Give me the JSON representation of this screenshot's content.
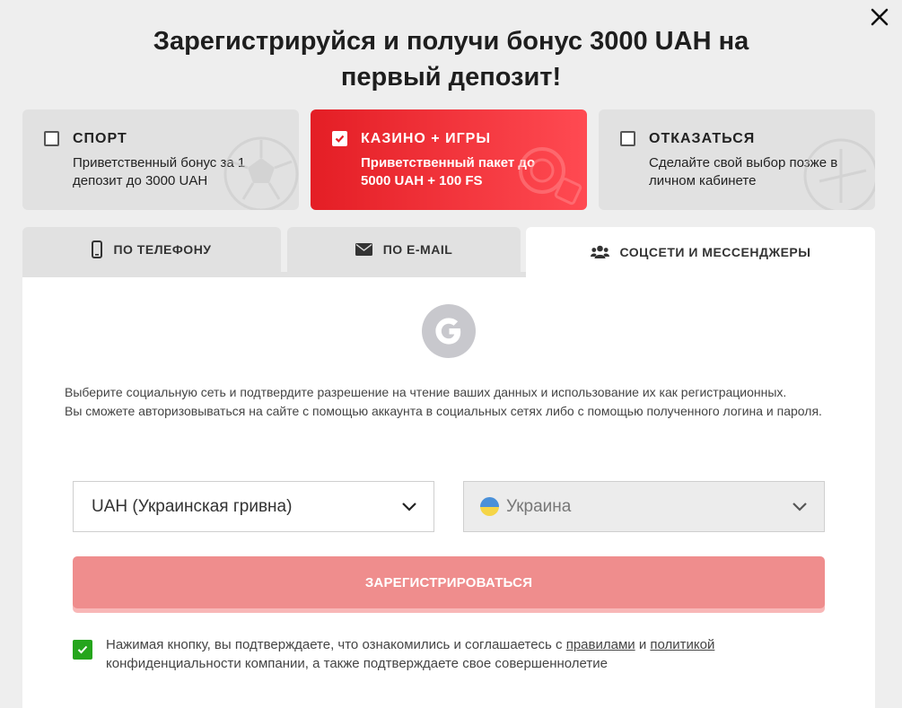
{
  "title_line1": "Зарегистрируйся и получи бонус 3000 UAH на",
  "title_line2": "первый депозит!",
  "bonuses": [
    {
      "name": "СПОРТ",
      "desc": "Приветственный бонус за 1 депозит до 3000 UAH",
      "checked": false
    },
    {
      "name": "КАЗИНО + ИГРЫ",
      "desc": "Приветственный пакет до 5000 UAH + 100 FS",
      "checked": true
    },
    {
      "name": "ОТКАЗАТЬСЯ",
      "desc": "Сделайте свой выбор позже в личном кабинете",
      "checked": false
    }
  ],
  "tabs": [
    {
      "label": "ПО ТЕЛЕФОНУ",
      "icon": "phone-icon"
    },
    {
      "label": "ПО E-MAIL",
      "icon": "envelope-icon"
    },
    {
      "label": "СОЦСЕТИ И МЕССЕНДЖЕРЫ",
      "icon": "users-icon",
      "active": true
    }
  ],
  "social": {
    "icon": "google-icon"
  },
  "info_line1": "Выберите социальную сеть и подтвердите разрешение на чтение ваших данных и использование их как регистрационных.",
  "info_line2": "Вы сможете авторизовываться на сайте с помощью аккаунта в социальных сетях либо с помощью полученного логина и пароля.",
  "currency": {
    "value": "UAH (Украинская гривна)"
  },
  "country": {
    "value": "Украина",
    "flag_colors": [
      "#4a90d9",
      "#f5d547"
    ]
  },
  "register_label": "Зарегистрироваться",
  "agreement": {
    "checked": true,
    "text_before": "Нажимая кнопку, вы подтверждаете, что ознакомились и соглашаетесь с ",
    "rules_link": "правилами",
    "and": " и ",
    "policy_link": "политикой",
    "text_after": " конфиденциальности компании, а также подтверждаете свое совершеннолетие"
  },
  "colors": {
    "accent": "#e41e25",
    "button": "#ef8d8d",
    "check_green": "#25a51c"
  }
}
